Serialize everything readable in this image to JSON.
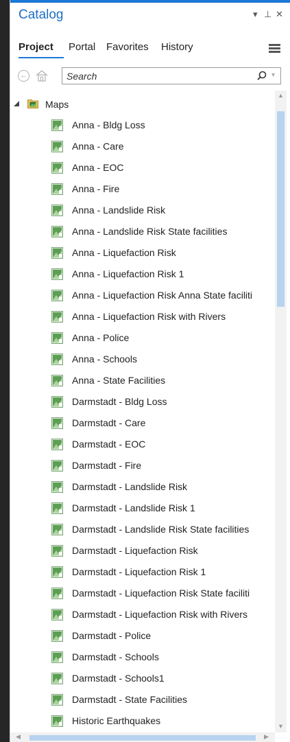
{
  "window": {
    "title": "Catalog",
    "controls": {
      "dropdown": "▾",
      "pin": "⊥",
      "close": "✕"
    }
  },
  "tabs": [
    {
      "label": "Project",
      "active": true
    },
    {
      "label": "Portal",
      "active": false
    },
    {
      "label": "Favorites",
      "active": false
    },
    {
      "label": "History",
      "active": false
    }
  ],
  "search": {
    "placeholder": "Search",
    "value": ""
  },
  "tree": {
    "root": {
      "label": "Maps",
      "icon": "folder-icon",
      "expanded": true
    },
    "items": [
      "Anna - Bldg Loss",
      "Anna - Care",
      "Anna - EOC",
      "Anna - Fire",
      "Anna - Landslide Risk",
      "Anna - Landslide Risk State facilities",
      "Anna - Liquefaction Risk",
      "Anna - Liquefaction Risk 1",
      "Anna - Liquefaction Risk Anna State faciliti",
      "Anna - Liquefaction Risk with Rivers",
      "Anna - Police",
      "Anna - Schools",
      "Anna - State Facilities",
      "Darmstadt - Bldg Loss",
      "Darmstadt - Care",
      "Darmstadt - EOC",
      "Darmstadt - Fire",
      "Darmstadt - Landslide Risk",
      "Darmstadt - Landslide Risk 1",
      "Darmstadt - Landslide Risk State facilities",
      "Darmstadt - Liquefaction Risk",
      "Darmstadt - Liquefaction Risk 1",
      "Darmstadt - Liquefaction Risk State faciliti",
      "Darmstadt - Liquefaction Risk with Rivers",
      "Darmstadt - Police",
      "Darmstadt - Schools",
      "Darmstadt - Schools1",
      "Darmstadt - State Facilities",
      "Historic Earthquakes"
    ]
  },
  "colors": {
    "accent": "#1e78d7",
    "title": "#1d6fbf",
    "scroll_thumb": "#b8d3ef",
    "left_bar": "#262626"
  }
}
